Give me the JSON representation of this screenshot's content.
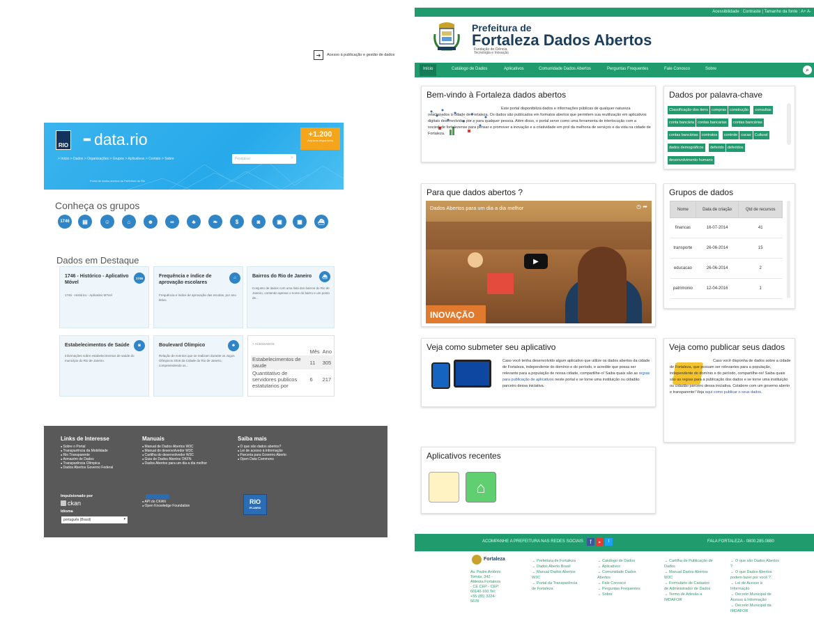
{
  "rio": {
    "logo_badge": "RIO",
    "logo_text": "data.rio",
    "counter_value": "+1.200",
    "counter_label": "Arquivos disponíveis",
    "nav": "> Início  > Dados  > Organizações  > Grupos  > Aplicativos  > Contato  > Sobre",
    "search_placeholder": "Pesquisar",
    "subtitle": "Portal de dados abertos da Prefeitura do Rio",
    "groups_title": "Conheça os grupos",
    "group_icons": [
      "1746",
      "doc-icon",
      "person-icon",
      "graduation-cap-icon",
      "theater-masks-icon",
      "bike-icon",
      "people-icon",
      "leaf-icon",
      "dollar-icon",
      "camera-icon",
      "bus-icon",
      "briefcase-icon",
      "ship-icon"
    ],
    "group_glyphs": [
      "1746",
      "▤",
      "☺",
      "⌂",
      "☻",
      "∞",
      "♣",
      "❧",
      "$",
      "◙",
      "▣",
      "▦",
      "⛴"
    ],
    "featured_title": "Dados em Destaque",
    "cards": [
      {
        "title": "1746 - Histórico - Aplicativo Móvel",
        "desc": "1746 - Histórico - Aplicativo M?vel",
        "icon": "1746"
      },
      {
        "title": "Frequência e índice de aprovação escolares",
        "desc": "Frequência e índice de aprovação das escolas, por ano letivo.",
        "icon": "⌂"
      },
      {
        "title": "Bairros do Rio de Janeiro",
        "desc": "Conjunto de dados com uma lista dos bairros do Rio de Janeiro, contendo apenas o nome do bairro e um ponto de...",
        "icon": "⛴"
      },
      {
        "title": "Estabelecimentos de Saúde",
        "desc": "Informações sobre estabelecimentos de saúde do município do Rio de Janeiro.",
        "icon": "◙"
      },
      {
        "title": "Boulevard Olímpico",
        "desc": "Relação de eventos que se realizam durante os Jogos Olímpicos 2016 da Cidade do Rio de Janeiro, compreendendo os...",
        "icon": "☻"
      }
    ],
    "access": {
      "header": "+ ACESSADOS",
      "col_month": "Mês",
      "col_year": "Ano",
      "rows": [
        {
          "name": "Estabelecimentos de saude",
          "month": "11",
          "year": "305"
        },
        {
          "name": "Quantitativo de servidores publicos estatutarios por",
          "month": "6",
          "year": "217"
        }
      ]
    },
    "footer": {
      "links_title": "Links de Interesse",
      "links": [
        "Sobre o Portal",
        "Transparência da Mobilidade",
        "Rio Transparente",
        "Armazém de Dados",
        "Transparência Olímpica",
        "Dados Abertos Governo Federal"
      ],
      "manuals_title": "Manuais",
      "manuals": [
        "Manual de Dados Abertos W3C",
        "Manual do desenvolvedor W3C",
        "Cartilha do desenvolvedor W3C",
        "Guia de Dados Abertos OKFN",
        "Dados Abertos para um dia a dia melhor"
      ],
      "more_title": "Saiba mais",
      "more": [
        "O que são dados abertos?",
        "Lei de acesso à informação",
        "Parceria para Governo Aberto",
        "Open Data Commons"
      ],
      "powered_label": "Impulsionado por",
      "ckan": "ckan",
      "language_label": "Idioma",
      "language_value": "português (Brasil)",
      "api": [
        "API do CKAN",
        "Open Knowledge Foundation"
      ],
      "flag_text": "RIO",
      "flag_sub": "IPLANRIO"
    }
  },
  "ftz": {
    "topbar": "Acessibilidade : Contraste  |  Tamanho da fonte : A+  A-",
    "pre_title": "Prefeitura de",
    "title": "Fortaleza  Dados Abertos",
    "foundation": "Fundação de Ciência,\nTecnologia e Inovação",
    "login": "Acesso à publicação e gestão de dados",
    "nav": [
      "Início",
      "Catálogo de Dados",
      "Aplicativos",
      "Comunidade Dados Abertos",
      "Perguntas Frequentes",
      "Fale Conosco",
      "Sobre"
    ],
    "welcome_title": "Bem-vindo à Fortaleza dados abertos",
    "welcome_text": "Este portal disponibiliza dados e informações públicas de qualquer natureza relacionados à cidade de Fortaleza. Os dados são publicados em formatos abertos que permitem sua reutilização em aplicativos digitais desenvolvidos por e para qualquer pessoa. Além disso, o portal serve como uma ferramenta de interlocução com a sociedade fortalezense para pensar e promover a inovação e a criatividade em prol da melhoria de serviços e da vida na cidade de Fortaleza.",
    "keywords_title": "Dados por palavra-chave",
    "keywords": [
      "Classificação dos itens",
      "compras",
      "construção",
      "consultas",
      "conta bancária",
      "contas bancarias",
      "contas bancárias",
      "contas bancárias",
      "contratos",
      "controle",
      "cucas",
      "Cultural",
      "dados demográficos",
      "deferido",
      "deferidos",
      "desenvolvimento humano"
    ],
    "why_title": "Para que dados abertos ?",
    "video_title": "Dados Abertos para um dia a dia melhor",
    "video_banner": "INOVAÇÃO",
    "groups_title": "Grupos de dados",
    "groups_head": [
      "Nome",
      "Data de criação",
      "Qtd de recursos"
    ],
    "groups": [
      {
        "name": "financas",
        "date": "16-07-2014",
        "qty": "41"
      },
      {
        "name": "transporte",
        "date": "26-06-2014",
        "qty": "15"
      },
      {
        "name": "educacao",
        "date": "26-06-2014",
        "qty": "2"
      },
      {
        "name": "patrimonio",
        "date": "12-04-2016",
        "qty": "1"
      }
    ],
    "submit_title": "Veja como submeter seu aplicativo",
    "submit_text_1": "Caso você tenha desenvolvido algum aplicativo que utilize os dados abertos da cidade de Fortaleza, independente do domínio e do período, e acredite que possa ser relevante para a população de nossa cidade, compartilhe-o! Saiba quais são as ",
    "submit_link": "regras para publicação de aplicativos",
    "submit_text_2": " neste portal e se torne uma instituição ou cidadão parceiro dessa iniciativa.",
    "publish_title": "Veja como publicar seus dados",
    "publish_text_1": "Caso você disponha de dados sobre a cidade de Fortaleza, que possam ser relevantes para a população, independente do domínio e do período, compartilhe-os! Saiba quais são as regras para a publicação dos dados e se torne uma instituição ou cidadão parceiro dessa iniciativa. Colabore com um governo aberto e transparente! Veja ",
    "publish_link": "aqui como publicar o seus dados",
    "publish_text_2": ".",
    "apps_title": "Aplicativos recentes",
    "social_label": "ACOMPANHE A PREFEITURA NAS REDES SOCIAIS",
    "phone_label": "FALA FORTALEZA - 0800.285.0880",
    "footer_logo": "Fortaleza",
    "address": "Av. Padre Antônio Tomás, 342 - Aldeota Fortaleza - CE CEP - CEP: 60140-160 Tel: +55 (85) 3224-5678",
    "footer_col1": [
      "Prefeitura de Fortaleza",
      "Dados Aberto Brasil",
      "Manual Dados Abertos W3C",
      "Portal da Transparência de Fortaleza"
    ],
    "footer_col2": [
      "Catálogo de Dados",
      "Aplicativos",
      "Comunidade Dados Abertos",
      "Fale Conosco",
      "Perguntas Frequentes",
      "Sobre"
    ],
    "footer_col3": [
      "Cartilha de Publicação de Dados",
      "Manual Dados Abertos W3C",
      "Formulário de Cadastro de Administrador de Dados",
      "Termo de Adesão a IMDAFOR"
    ],
    "footer_col4": [
      "O que são Dados Abertos ?",
      "O que Dados Abertos podem fazer por você ?",
      "Lei de Acesso à Informação",
      "Decreto Municipal de Acesso à Informação",
      "Decreto Municipal da IMDAFOR"
    ]
  },
  "colors": {
    "rio_blue": "#2aabea",
    "rio_accent": "#f4a51c",
    "ftz_green": "#1f9b6e",
    "rio_footer": "#595959"
  }
}
